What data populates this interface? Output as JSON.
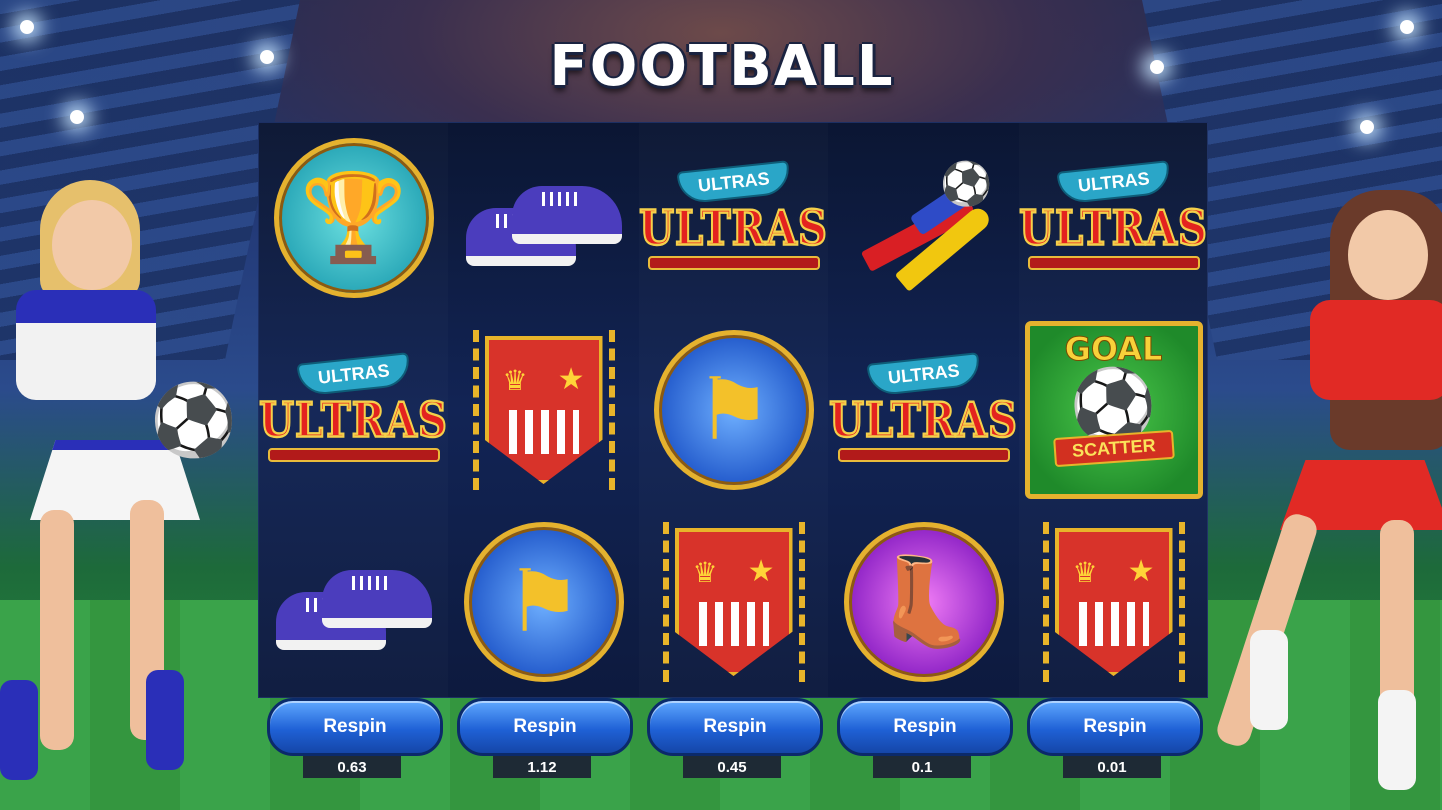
{
  "game": {
    "title": "FOOTBALL"
  },
  "reels": [
    {
      "symbols": [
        "golden-ball-trophy",
        "ultras-banner",
        "purple-sneakers"
      ]
    },
    {
      "symbols": [
        "purple-sneakers",
        "red-pennant",
        "corner-flag"
      ]
    },
    {
      "symbols": [
        "ultras-banner",
        "corner-flag",
        "red-pennant"
      ]
    },
    {
      "symbols": [
        "vuvuzela-horn",
        "ultras-banner",
        "golden-boot"
      ]
    },
    {
      "symbols": [
        "ultras-banner",
        "goal-scatter",
        "red-pennant"
      ]
    }
  ],
  "symbol_text": {
    "ultras_small": "ULTRAS",
    "ultras_big": "ULTRAS",
    "goal": "GOAL",
    "scatter": "SCATTER"
  },
  "respin": [
    {
      "label": "Respin",
      "price": "0.63"
    },
    {
      "label": "Respin",
      "price": "1.12"
    },
    {
      "label": "Respin",
      "price": "0.45"
    },
    {
      "label": "Respin",
      "price": "0.1"
    },
    {
      "label": "Respin",
      "price": "0.01"
    }
  ],
  "colors": {
    "respin_button": "#1f61d6",
    "frame_gold": "#e5b22e",
    "board_bg": "#0b1633"
  }
}
